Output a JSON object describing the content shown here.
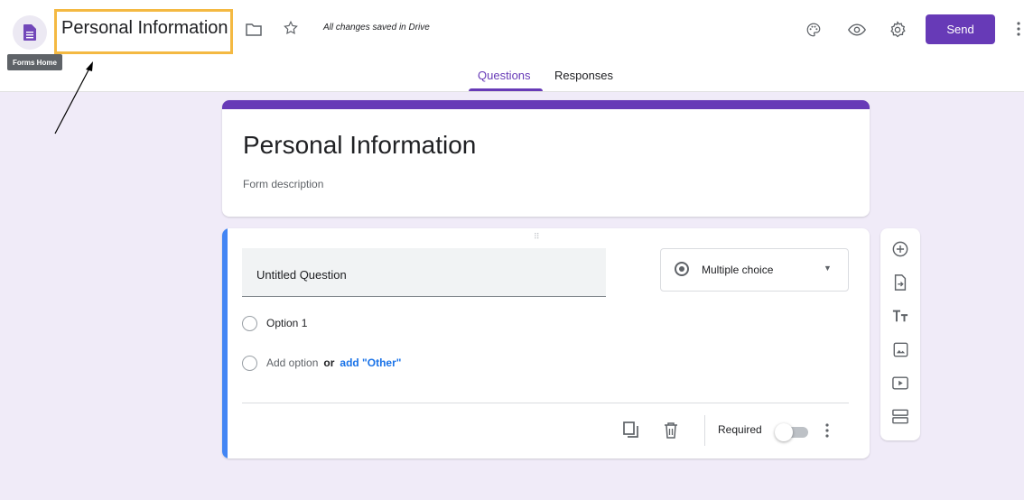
{
  "header": {
    "doc_title": "Personal Information",
    "saved_status": "All changes saved in Drive",
    "send_label": "Send",
    "forms_home_tooltip": "Forms Home",
    "icons": [
      "forms-logo-icon",
      "folder-icon",
      "star-icon",
      "palette-icon",
      "eye-icon",
      "gear-icon",
      "more-vert-icon"
    ]
  },
  "tabs": [
    {
      "label": "Questions",
      "active": true
    },
    {
      "label": "Responses",
      "active": false
    }
  ],
  "form": {
    "title": "Personal Information",
    "description_placeholder": "Form description"
  },
  "question": {
    "title": "Untitled Question",
    "type": "Multiple choice",
    "options": [
      "Option 1"
    ],
    "add_option": "Add option",
    "or": "or",
    "add_other": "add \"Other\"",
    "required_label": "Required",
    "required": false
  },
  "side_tools": [
    "add-question-icon",
    "import-questions-icon",
    "add-title-icon",
    "add-image-icon",
    "add-video-icon",
    "add-section-icon"
  ],
  "colors": {
    "accent": "#673ab7",
    "background": "#f0ebf8",
    "active_card": "#4285f4",
    "highlight_box": "#f4b942"
  }
}
